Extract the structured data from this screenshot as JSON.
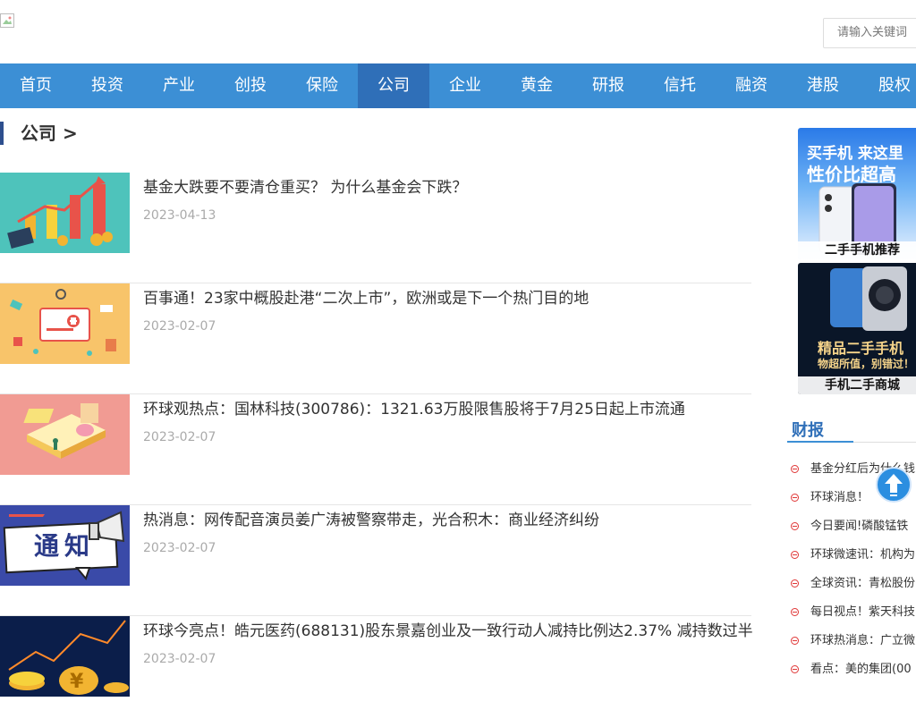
{
  "search": {
    "placeholder": "请输入关键词"
  },
  "nav": {
    "items": [
      "首页",
      "投资",
      "产业",
      "创投",
      "保险",
      "公司",
      "企业",
      "黄金",
      "研报",
      "信托",
      "融资",
      "港股",
      "股权"
    ],
    "active_index": 5
  },
  "section": {
    "title": "公司 >"
  },
  "articles": [
    {
      "title": "基金大跌要不要清仓重买？ 为什么基金会下跌？",
      "date": "2023-04-13"
    },
    {
      "title": "百事通！23家中概股赴港“二次上市”，欧洲或是下一个热门目的地",
      "date": "2023-02-07"
    },
    {
      "title": "环球观热点：国林科技(300786)：1321.63万股限售股将于7月25日起上市流通",
      "date": "2023-02-07"
    },
    {
      "title": "热消息：网传配音演员姜广涛被警察带走，光合积木：商业经济纠纷",
      "date": "2023-02-07"
    },
    {
      "title": "环球今亮点！皓元医药(688131)股东景嘉创业及一致行动人减持比例达2.37% 减持数过半",
      "date": "2023-02-07"
    }
  ],
  "ads": [
    {
      "caption": "二手手机推荐",
      "banner_line1": "买手机 来这里",
      "banner_line2": "性价比超高"
    },
    {
      "caption": "手机二手商城",
      "banner_line1": "精品二手手机",
      "banner_line2": "物超所值，别错过！"
    }
  ],
  "sidebar": {
    "title": "财报",
    "items": [
      "基金分红后为什么钱",
      "环球消息！",
      "今日要闻!磷酸锰铁",
      "环球微速讯：机构为",
      "全球资讯：青松股份",
      "每日视点！紫天科技",
      "环球热消息：广立微",
      "看点：美的集团(00"
    ]
  },
  "thumb_text": {
    "notice": "通知"
  },
  "colors": {
    "nav_bg": "#3c8fd5",
    "nav_active": "#2f6fb8",
    "accent": "#2f6fb8",
    "bullet": "#e03838"
  }
}
